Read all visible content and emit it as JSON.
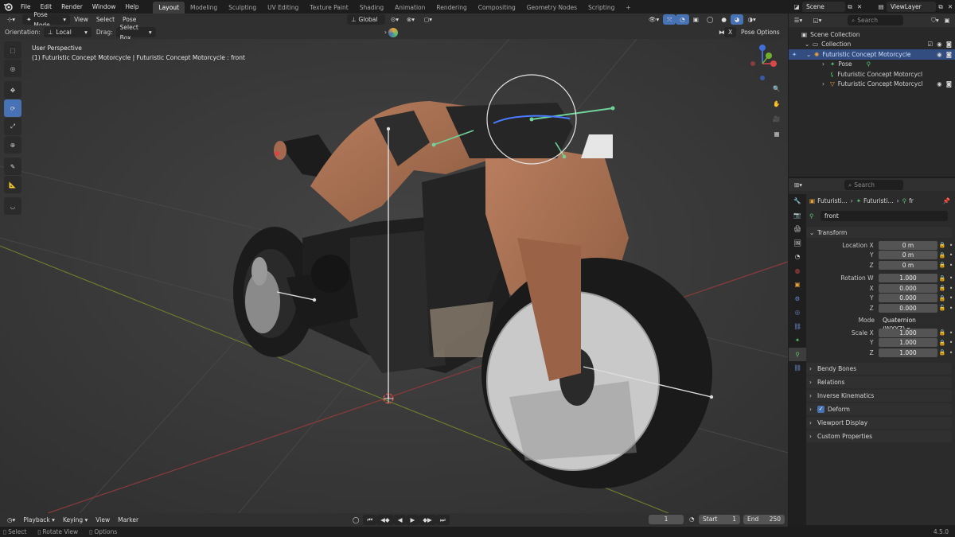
{
  "menu": [
    "File",
    "Edit",
    "Render",
    "Window",
    "Help"
  ],
  "workspaces": [
    "Layout",
    "Modeling",
    "Sculpting",
    "UV Editing",
    "Texture Paint",
    "Shading",
    "Animation",
    "Rendering",
    "Compositing",
    "Geometry Nodes",
    "Scripting"
  ],
  "active_workspace": "Layout",
  "scene": "Scene",
  "view_layer": "ViewLayer",
  "header": {
    "mode": "Pose Mode",
    "menus": [
      "View",
      "Select",
      "Pose"
    ],
    "transform_orientation": "Global"
  },
  "tool_settings": {
    "orientation_label": "Orientation:",
    "orientation_value": "Local",
    "drag_label": "Drag:",
    "drag_value": "Select Box",
    "pose_options": "Pose Options",
    "x_mirror": "X"
  },
  "viewport": {
    "perspective": "User Perspective",
    "object_info": "(1) Futuristic Concept Motorcycle | Futuristic Concept Motorcycle : front"
  },
  "outliner": {
    "search_placeholder": "Search",
    "scene_collection": "Scene Collection",
    "collection": "Collection",
    "items": [
      {
        "label": "Futuristic Concept Motorcycle",
        "selected": true
      },
      {
        "label": "Pose",
        "selected": false
      },
      {
        "label": "Futuristic Concept Motorcycl",
        "selected": false
      },
      {
        "label": "Futuristic Concept Motorcycl",
        "selected": false
      }
    ]
  },
  "properties": {
    "search_placeholder": "Search",
    "breadcrumb": [
      "Futuristi...",
      "Futuristi...",
      "fr"
    ],
    "bone_name": "front",
    "transform_label": "Transform",
    "location": {
      "label": "Location X",
      "x": "0 m",
      "y": "0 m",
      "z": "0 m"
    },
    "rotation": {
      "label": "Rotation W",
      "w": "1.000",
      "x": "0.000",
      "y": "0.000",
      "z": "0.000"
    },
    "mode_label": "Mode",
    "mode_value": "Quaternion (WXYZ)",
    "scale": {
      "label": "Scale X",
      "x": "1.000",
      "y": "1.000",
      "z": "1.000"
    },
    "axis": {
      "x": "X",
      "y": "Y",
      "z": "Z"
    },
    "panels": [
      "Bendy Bones",
      "Relations",
      "Inverse Kinematics",
      "Deform",
      "Viewport Display",
      "Custom Properties"
    ]
  },
  "timeline": {
    "menus": [
      "Playback",
      "Keying",
      "View",
      "Marker"
    ],
    "current_frame": "1",
    "start_label": "Start",
    "start": "1",
    "end_label": "End",
    "end": "250"
  },
  "status": {
    "select": "Select",
    "rotate": "Rotate View",
    "options": "Options",
    "version": "4.5.0"
  },
  "colors": {
    "accent": "#4772b3",
    "selection": "#334d80",
    "bone_green": "#6fd39a",
    "body_copper": "#a66f52"
  }
}
